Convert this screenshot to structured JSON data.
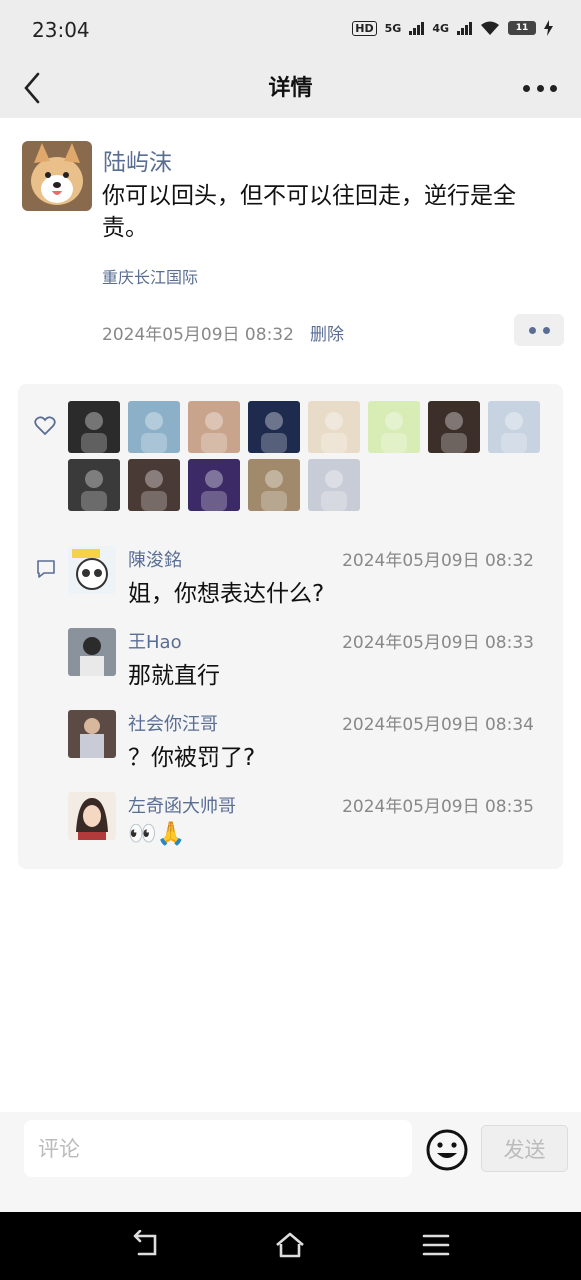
{
  "status": {
    "time": "23:04",
    "hd": "HD",
    "net1": "5G",
    "net2": "4G",
    "battery": "11"
  },
  "nav": {
    "title": "详情"
  },
  "post": {
    "author": "陆屿沫",
    "text": "你可以回头，但不可以往回走，逆行是全责。",
    "location": "重庆长江国际",
    "time": "2024年05月09日 08:32",
    "delete_label": "删除"
  },
  "likes": {
    "icon": "heart-icon",
    "avatars": [
      "#2b2b2b",
      "#8bb0c8",
      "#c9a48d",
      "#1e2b4f",
      "#e8dcc9",
      "#d8ecb6",
      "#3c2f2a",
      "#c7d3e0",
      "#3a3a3a",
      "#4a3a35",
      "#3b2a66",
      "#a08a6b",
      "#c8ccd6"
    ]
  },
  "comments": [
    {
      "name": "陳浚銘",
      "time": "2024年05月09日 08:32",
      "text": "姐，你想表达什么?"
    },
    {
      "name": "王Hao",
      "time": "2024年05月09日 08:33",
      "text": "那就直行"
    },
    {
      "name": "社会你汪哥",
      "time": "2024年05月09日 08:34",
      "text": "？你被罚了?"
    },
    {
      "name": "左奇函大帅哥",
      "time": "2024年05月09日 08:35",
      "text": "👀🙏"
    }
  ],
  "input": {
    "placeholder": "评论",
    "send_label": "发送"
  }
}
